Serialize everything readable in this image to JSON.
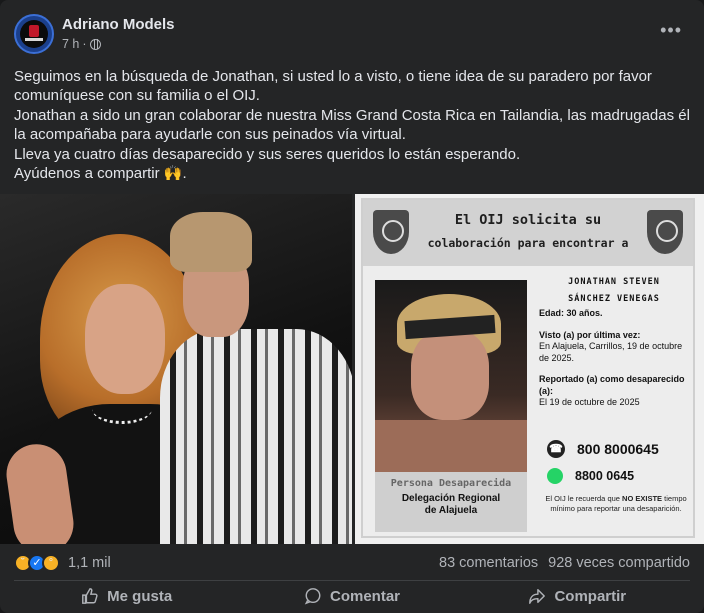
{
  "post": {
    "author": "Adriano Models",
    "time": "7 h",
    "separator": "·",
    "paragraphs": [
      "Seguimos en la búsqueda de Jonathan, si usted lo a visto, o tiene idea de su paradero por favor comuníquese con su familia o el OIJ.",
      "Jonathan a sido un gran colaborar de nuestra Miss Grand Costa Rica en Tailandia, las madrugadas él la acompañaba para ayudarle con sus peinados vía virtual.",
      "Lleva ya cuatro días desaparecido y sus seres queridos lo están esperando.",
      "Ayúdenos a compartir 🙌."
    ],
    "more_icon": "more-horizontal-icon",
    "privacy_icon": "globe-icon"
  },
  "poster": {
    "title": "El OIJ solicita su",
    "subtitle": "colaboración para encontrar a",
    "name_line1": "JONATHAN STEVEN",
    "name_line2": "SÁNCHEZ VENEGAS",
    "age": "Edad: 30 años.",
    "last_seen_label": "Visto (a) por última vez:",
    "last_seen_value": "En Alajuela, Carrillos, 19 de octubre de 2025.",
    "reported_label": "Reportado (a) como desaparecido (a):",
    "reported_value": "El 19 de octubre de 2025",
    "phone1": "800 8000645",
    "phone2": "8800 0645",
    "caption_top": "Persona Desaparecida",
    "caption_line1": "Delegación Regional",
    "caption_line2": "de Alajuela",
    "notice_pre": "El OIJ le recuerda que ",
    "notice_bold": "NO EXISTE",
    "notice_post": " tiempo mínimo para reportar una desaparición."
  },
  "footer": {
    "reaction_count": "1,1 mil",
    "comments": "83 comentarios",
    "shares": "928 veces compartido",
    "like_label": "Me gusta",
    "comment_label": "Comentar",
    "share_label": "Compartir"
  }
}
